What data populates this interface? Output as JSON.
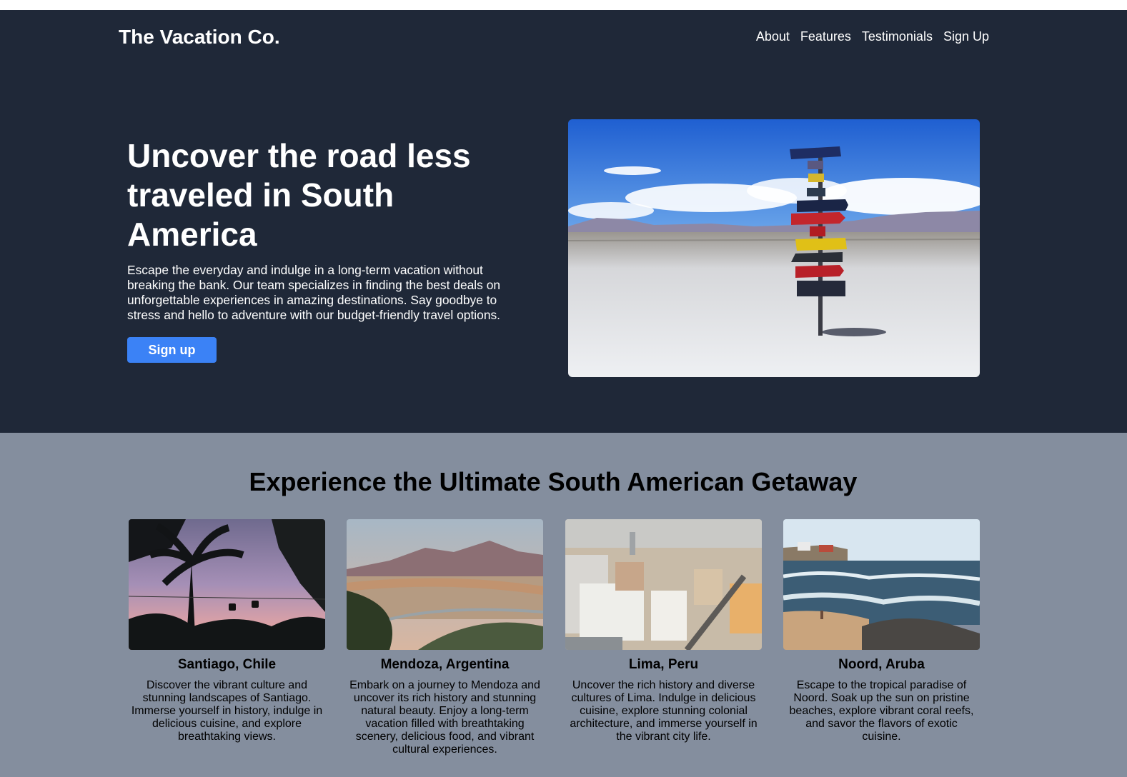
{
  "header": {
    "brand": "The Vacation Co.",
    "nav": [
      "About",
      "Features",
      "Testimonials",
      "Sign Up"
    ]
  },
  "hero": {
    "title": "Uncover the road less traveled in South America",
    "description": "Escape the everyday and indulge in a long-term vacation without breaking the bank. Our team specializes in finding the best deals on unforgettable experiences in amazing destinations. Say goodbye to stress and hello to adventure with our budget-friendly travel options.",
    "cta_label": "Sign up"
  },
  "features": {
    "title": "Experience the Ultimate South American Getaway",
    "cards": [
      {
        "title": "Santiago, Chile",
        "description": "Discover the vibrant culture and stunning landscapes of Santiago. Immerse yourself in history, indulge in delicious cuisine, and explore breathtaking views."
      },
      {
        "title": "Mendoza, Argentina",
        "description": "Embark on a journey to Mendoza and uncover its rich history and stunning natural beauty. Enjoy a long-term vacation filled with breathtaking scenery, delicious food, and vibrant cultural experiences."
      },
      {
        "title": "Lima, Peru",
        "description": "Uncover the rich history and diverse cultures of Lima. Indulge in delicious cuisine, explore stunning colonial architecture, and immerse yourself in the vibrant city life."
      },
      {
        "title": "Noord, Aruba",
        "description": "Escape to the tropical paradise of Noord. Soak up the sun on pristine beaches, explore vibrant coral reefs, and savor the flavors of exotic cuisine."
      }
    ]
  },
  "sign_text": [
    "SAN PEDRO DE ATACAMA 250 Km",
    "BUENOS AIRES",
    "TOKIO 17.250 Km",
    "IGUAZU 1.187 Km"
  ],
  "colors": {
    "hero_bg": "#1f2838",
    "features_bg": "#848e9e",
    "accent": "#3b82f6"
  }
}
